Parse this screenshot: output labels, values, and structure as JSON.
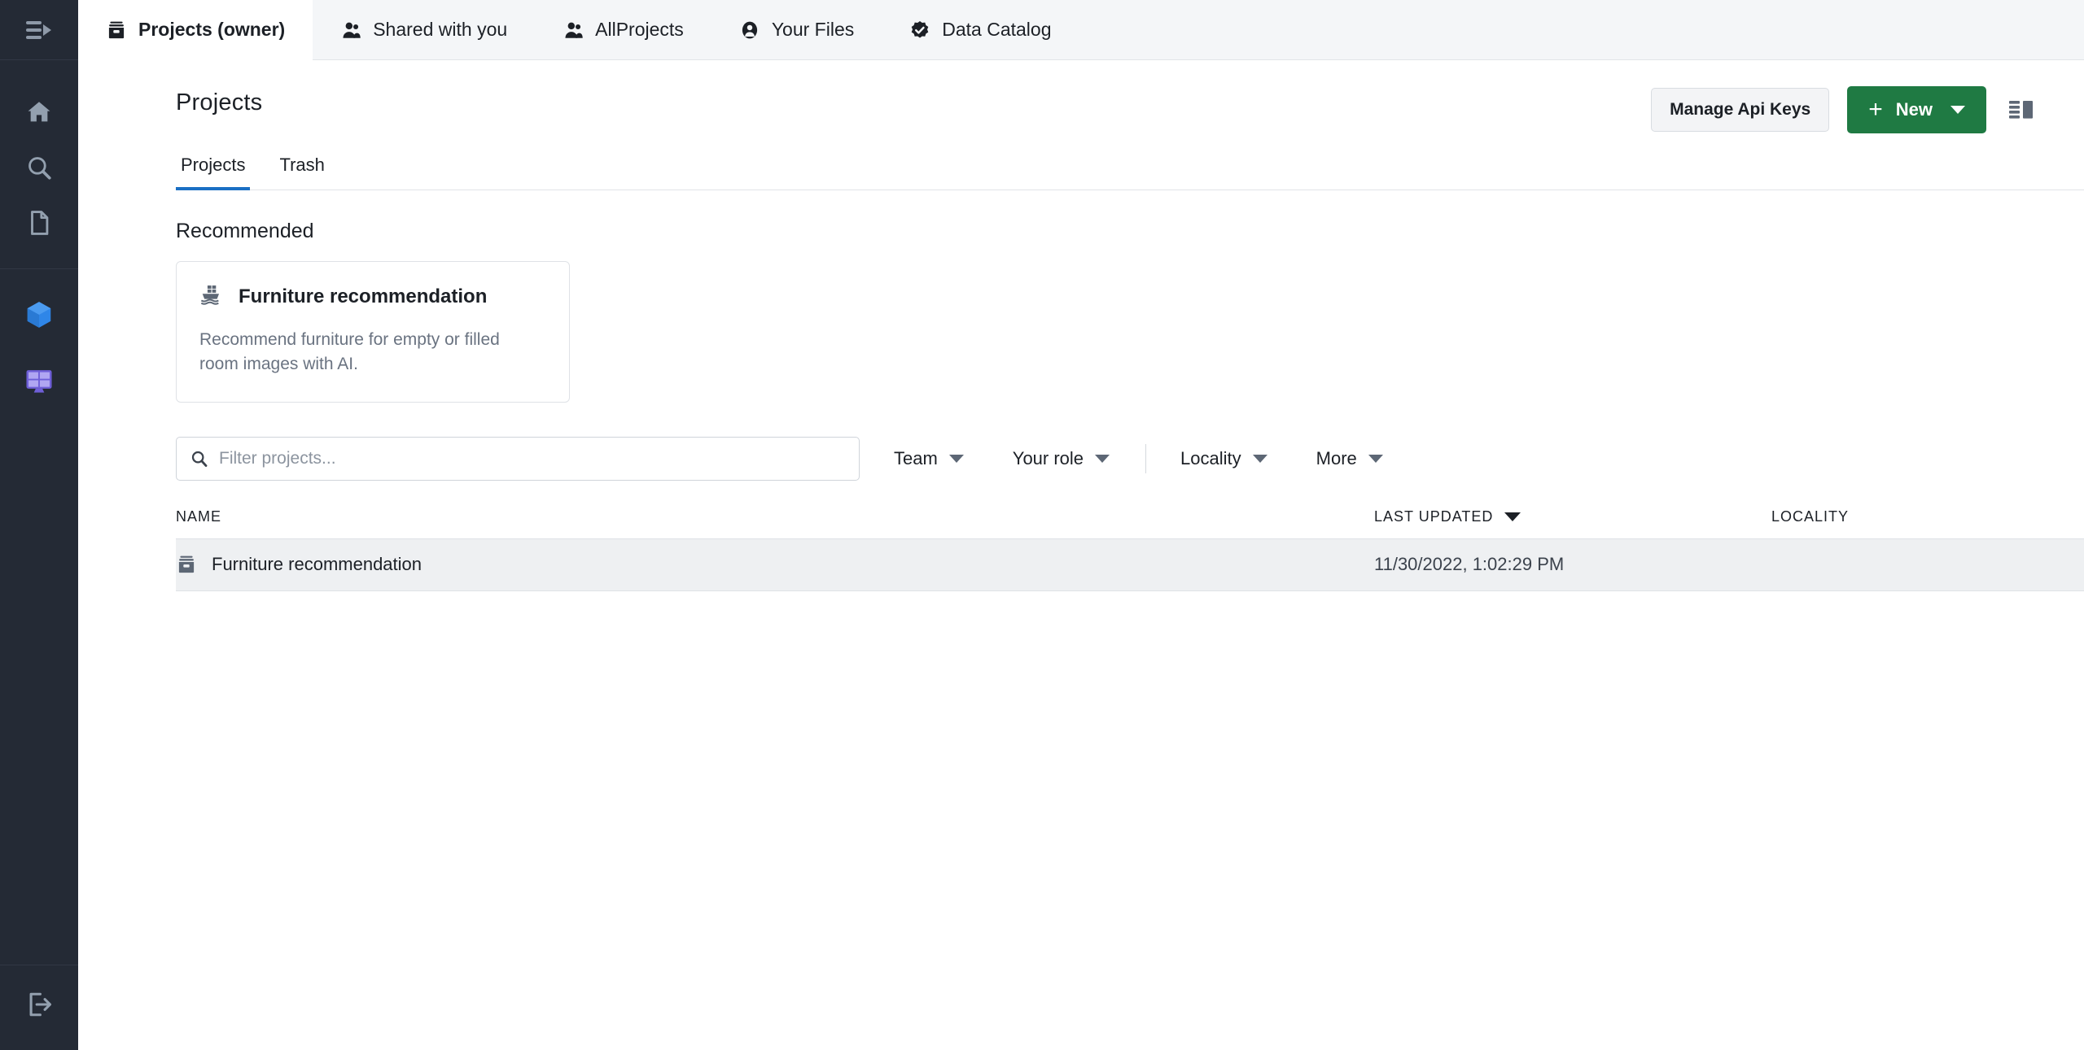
{
  "rail": {
    "toggle_icon": "sidebar-expand-icon",
    "items": [
      {
        "icon": "home-icon",
        "name": "home"
      },
      {
        "icon": "search-icon",
        "name": "search"
      },
      {
        "icon": "file-icon",
        "name": "files"
      },
      {
        "icon": "cube-icon",
        "name": "deployments"
      },
      {
        "icon": "dashboard-icon",
        "name": "dashboards"
      }
    ],
    "logout_icon": "logout-icon"
  },
  "window_tabs": [
    {
      "label": "Projects (owner)",
      "icon": "archive-icon",
      "active": true
    },
    {
      "label": "Shared with you",
      "icon": "people-icon",
      "active": false
    },
    {
      "label": "AllProjects",
      "icon": "people-icon",
      "active": false
    },
    {
      "label": "Your Files",
      "icon": "person-circle-icon",
      "active": false
    },
    {
      "label": "Data Catalog",
      "icon": "check-badge-icon",
      "active": false
    }
  ],
  "header": {
    "title": "Projects",
    "manage_api_keys_label": "Manage Api Keys",
    "new_label": "New",
    "new_plus": "+",
    "view_toggle_icon": "list-view-icon",
    "accent_green": "#1f7a43",
    "accent_blue": "#1a6fc4"
  },
  "subtabs": [
    {
      "label": "Projects",
      "active": true
    },
    {
      "label": "Trash",
      "active": false
    }
  ],
  "recommended": {
    "section_title": "Recommended",
    "cards": [
      {
        "icon": "ship-icon",
        "title": "Furniture recommendation",
        "description": "Recommend furniture for empty or filled room images with AI."
      }
    ]
  },
  "filters": {
    "search_placeholder": "Filter projects...",
    "search_value": "",
    "search_icon": "search-icon",
    "dropdowns": [
      {
        "label": "Team"
      },
      {
        "label": "Your role"
      },
      {
        "label": "Locality"
      },
      {
        "label": "More"
      }
    ]
  },
  "table": {
    "columns": [
      {
        "key": "name",
        "label": "NAME",
        "sorted": false
      },
      {
        "key": "updated",
        "label": "LAST UPDATED",
        "sorted": true
      },
      {
        "key": "locality",
        "label": "LOCALITY",
        "sorted": false
      }
    ],
    "rows": [
      {
        "icon": "archive-icon",
        "name": "Furniture recommendation",
        "updated": "11/30/2022, 1:02:29 PM",
        "locality": ""
      }
    ]
  }
}
